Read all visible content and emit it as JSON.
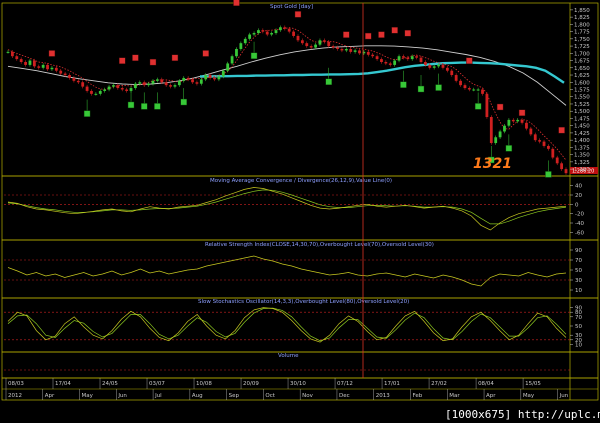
{
  "chart_data": {
    "type": "line",
    "title": "Spot Gold [day]",
    "instrument": "Spot Gold",
    "period": "day",
    "annotation_big": "1321",
    "last_price_box": "1,286.20",
    "watermark": "[1000x675] http://uplc.me/",
    "colors": {
      "background": "#000000",
      "panel_border": "#b8b000",
      "price_ma_teal": "#35c8d0",
      "price_ma_white": "#d0d0d0",
      "price_ma_red": "#e03030",
      "indicator_line": "#c8c820",
      "indicator_signal": "#8ac820",
      "level_line": "#cc2222",
      "cursor_line": "#dd3322",
      "signal_green": "#38c838",
      "signal_red": "#e03030",
      "axis_text": "#c8c8c8",
      "panel_title": "#8ea0ff",
      "big_label": "#ff7a1a"
    },
    "price_axis": {
      "ticks": [
        "1,850",
        "1,825",
        "1,800",
        "1,775",
        "1,750",
        "1,725",
        "1,700",
        "1,675",
        "1,650",
        "1,625",
        "1,600",
        "1,575",
        "1,550",
        "1,525",
        "1,500",
        "1,475",
        "1,450",
        "1,425",
        "1,400",
        "1,375",
        "1,350",
        "1,325",
        "1,300"
      ],
      "range": [
        1290,
        1860
      ]
    },
    "panels": {
      "macd": {
        "title": "Moving Average Convergence / Divergence(26,12,9),Value Line(0)",
        "ticks": [
          "40",
          "20",
          "0",
          "-20",
          "-40",
          "-60"
        ],
        "range": [
          -70,
          50
        ]
      },
      "rsi": {
        "title": "Relative Strength Index(CLOSE,14,30,70),Overbought Level(70),Oversold Level(30)",
        "ticks": [
          "90",
          "70",
          "50",
          "30",
          "10"
        ],
        "range": [
          0,
          100
        ]
      },
      "stoch": {
        "title": "Slow Stochastics Oscillator(14,3,3),Overbought Level(80),Oversold Level(20)",
        "ticks": [
          "90",
          "80",
          "70",
          "50",
          "30",
          "20",
          "10"
        ],
        "range": [
          0,
          100
        ]
      },
      "volume": {
        "title": "Volume"
      }
    },
    "x_axis": {
      "dates": [
        "08/03",
        "17/04",
        "24/05",
        "03/07",
        "10/08",
        "20/09",
        "30/10",
        "07/12",
        "17/01",
        "27/02",
        "08/04",
        "15/05"
      ],
      "months": [
        "2012",
        "Apr",
        "May",
        "Jun",
        "Jul",
        "Aug",
        "Sep",
        "Oct",
        "Nov",
        "Dec",
        "2013",
        "Feb",
        "Mar",
        "Apr",
        "May",
        "Jun"
      ]
    },
    "price_series": [
      1705,
      1690,
      1680,
      1670,
      1660,
      1675,
      1655,
      1650,
      1660,
      1645,
      1650,
      1640,
      1630,
      1625,
      1615,
      1605,
      1600,
      1585,
      1570,
      1560,
      1560,
      1570,
      1575,
      1585,
      1590,
      1580,
      1575,
      1570,
      1580,
      1595,
      1600,
      1590,
      1595,
      1605,
      1610,
      1600,
      1590,
      1585,
      1590,
      1605,
      1615,
      1610,
      1600,
      1595,
      1610,
      1625,
      1615,
      1610,
      1620,
      1640,
      1665,
      1690,
      1715,
      1735,
      1750,
      1765,
      1770,
      1780,
      1775,
      1765,
      1770,
      1780,
      1790,
      1785,
      1775,
      1760,
      1745,
      1735,
      1725,
      1720,
      1730,
      1745,
      1740,
      1725,
      1720,
      1715,
      1710,
      1715,
      1705,
      1710,
      1700,
      1705,
      1695,
      1690,
      1680,
      1670,
      1665,
      1660,
      1675,
      1690,
      1685,
      1680,
      1690,
      1685,
      1670,
      1660,
      1650,
      1655,
      1660,
      1650,
      1640,
      1625,
      1605,
      1590,
      1580,
      1575,
      1575,
      1575,
      1560,
      1480,
      1390,
      1410,
      1430,
      1450,
      1470,
      1465,
      1470,
      1460,
      1440,
      1420,
      1400,
      1395,
      1380,
      1370,
      1340,
      1320,
      1300,
      1286
    ],
    "ma_teal": [
      1620,
      1620,
      1621,
      1621,
      1622,
      1622,
      1623,
      1623,
      1624,
      1624,
      1625,
      1625,
      1626,
      1626,
      1627,
      1627,
      1628,
      1629,
      1631,
      1635,
      1640,
      1646,
      1652,
      1657,
      1660,
      1663,
      1666,
      1667,
      1668,
      1668,
      1667,
      1666,
      1664,
      1661,
      1658,
      1655,
      1650,
      1640,
      1620,
      1598
    ],
    "ma_white": [
      1655,
      1648,
      1640,
      1630,
      1620,
      1612,
      1605,
      1598,
      1594,
      1592,
      1594,
      1598,
      1605,
      1615,
      1628,
      1642,
      1655,
      1670,
      1683,
      1695,
      1705,
      1712,
      1718,
      1722,
      1724,
      1726,
      1726,
      1725,
      1722,
      1718,
      1712,
      1704,
      1696,
      1686,
      1672,
      1655,
      1632,
      1600,
      1560,
      1520
    ],
    "macd_series": [
      5,
      2,
      -5,
      -10,
      -12,
      -15,
      -18,
      -20,
      -18,
      -15,
      -12,
      -10,
      -14,
      -16,
      -10,
      -5,
      -8,
      -10,
      -6,
      -4,
      -2,
      4,
      10,
      18,
      25,
      32,
      36,
      34,
      28,
      22,
      14,
      6,
      -2,
      -8,
      -10,
      -8,
      -5,
      -2,
      0,
      -4,
      -6,
      -4,
      -2,
      -5,
      -8,
      -6,
      -4,
      -8,
      -14,
      -25,
      -45,
      -55,
      -40,
      -28,
      -20,
      -15,
      -10,
      -8,
      -6,
      -4
    ],
    "macd_signal": [
      3,
      1,
      -3,
      -7,
      -10,
      -12,
      -15,
      -17,
      -17,
      -16,
      -14,
      -12,
      -12,
      -13,
      -12,
      -10,
      -9,
      -9,
      -8,
      -6,
      -4,
      0,
      5,
      11,
      17,
      23,
      28,
      31,
      30,
      26,
      20,
      13,
      6,
      -1,
      -5,
      -7,
      -7,
      -5,
      -3,
      -2,
      -3,
      -4,
      -3,
      -4,
      -6,
      -6,
      -5,
      -6,
      -10,
      -17,
      -30,
      -42,
      -42,
      -36,
      -28,
      -22,
      -16,
      -12,
      -9,
      -6
    ],
    "rsi_series": [
      55,
      48,
      40,
      45,
      38,
      42,
      35,
      40,
      45,
      38,
      42,
      48,
      40,
      45,
      52,
      44,
      48,
      42,
      46,
      50,
      52,
      58,
      62,
      66,
      70,
      74,
      78,
      72,
      68,
      62,
      58,
      52,
      48,
      44,
      40,
      42,
      45,
      40,
      38,
      42,
      44,
      40,
      36,
      42,
      38,
      34,
      40,
      36,
      30,
      22,
      18,
      35,
      42,
      40,
      38,
      45,
      40,
      36,
      42,
      44
    ],
    "stoch_series": [
      60,
      80,
      72,
      40,
      20,
      28,
      55,
      70,
      48,
      30,
      22,
      40,
      65,
      82,
      70,
      45,
      25,
      18,
      35,
      60,
      75,
      50,
      30,
      22,
      40,
      68,
      85,
      90,
      88,
      80,
      62,
      40,
      22,
      15,
      30,
      55,
      72,
      60,
      38,
      20,
      25,
      50,
      72,
      82,
      60,
      35,
      18,
      22,
      48,
      70,
      80,
      62,
      40,
      20,
      30,
      55,
      78,
      70,
      45,
      25
    ],
    "stoch_signal": [
      55,
      72,
      74,
      55,
      30,
      25,
      45,
      62,
      56,
      38,
      26,
      34,
      55,
      75,
      75,
      55,
      32,
      22,
      30,
      50,
      68,
      58,
      38,
      26,
      34,
      58,
      78,
      88,
      89,
      84,
      70,
      48,
      28,
      18,
      24,
      46,
      64,
      64,
      45,
      26,
      23,
      42,
      63,
      78,
      68,
      44,
      24,
      20,
      38,
      60,
      76,
      68,
      48,
      28,
      28,
      46,
      68,
      72,
      54,
      32
    ],
    "buy_signals": [
      {
        "idx": 18,
        "price": 1540
      },
      {
        "idx": 28,
        "price": 1570
      },
      {
        "idx": 31,
        "price": 1565
      },
      {
        "idx": 34,
        "price": 1565
      },
      {
        "idx": 40,
        "price": 1580
      },
      {
        "idx": 56,
        "price": 1740
      },
      {
        "idx": 73,
        "price": 1650
      },
      {
        "idx": 90,
        "price": 1640
      },
      {
        "idx": 94,
        "price": 1625
      },
      {
        "idx": 98,
        "price": 1630
      },
      {
        "idx": 107,
        "price": 1565
      },
      {
        "idx": 110,
        "price": 1380
      },
      {
        "idx": 114,
        "price": 1420
      },
      {
        "idx": 123,
        "price": 1330
      }
    ],
    "sell_signals": [
      {
        "idx": 10,
        "price": 1665
      },
      {
        "idx": 26,
        "price": 1640
      },
      {
        "idx": 29,
        "price": 1650
      },
      {
        "idx": 33,
        "price": 1635
      },
      {
        "idx": 38,
        "price": 1650
      },
      {
        "idx": 45,
        "price": 1665
      },
      {
        "idx": 52,
        "price": 1840
      },
      {
        "idx": 66,
        "price": 1800
      },
      {
        "idx": 77,
        "price": 1730
      },
      {
        "idx": 82,
        "price": 1725
      },
      {
        "idx": 85,
        "price": 1730
      },
      {
        "idx": 88,
        "price": 1745
      },
      {
        "idx": 91,
        "price": 1735
      },
      {
        "idx": 105,
        "price": 1640
      },
      {
        "idx": 112,
        "price": 1480
      },
      {
        "idx": 117,
        "price": 1460
      },
      {
        "idx": 126,
        "price": 1400
      }
    ],
    "cursor_index": 82
  }
}
